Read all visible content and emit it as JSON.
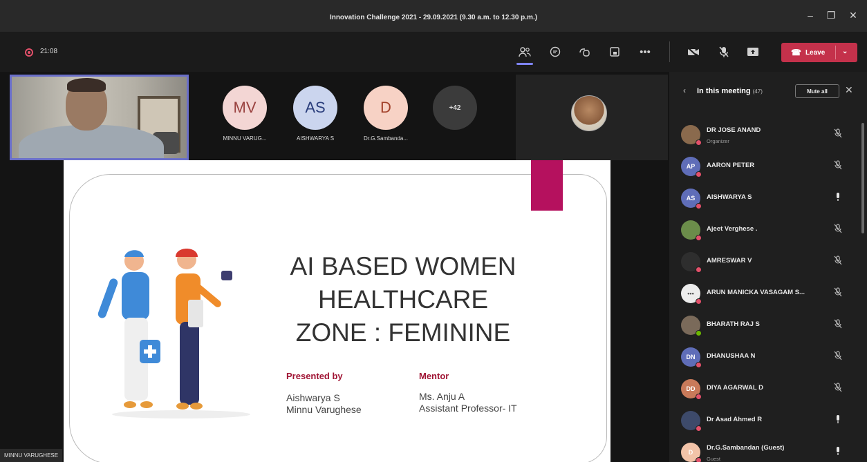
{
  "window": {
    "title": "Innovation Challenge 2021 - 29.09.2021 (9.30 a.m. to 12.30 p.m.)",
    "controls": [
      "minimize",
      "maximize",
      "close"
    ]
  },
  "toolbar": {
    "timer": "21:08",
    "leave_label": "Leave"
  },
  "stage": {
    "self_name": "MINNU VARUGHESE",
    "avatars": [
      {
        "initials": "MV",
        "name": "MINNU VARUG...",
        "color": "#f3d6d4",
        "text_color": "#9a4240"
      },
      {
        "initials": "AS",
        "name": "AISHWARYA S",
        "color": "#cbd5ee",
        "text_color": "#2c3f7d"
      },
      {
        "initials": "D",
        "name": "Dr.G.Sambanda...",
        "color": "#f7d2c5",
        "text_color": "#a2412a"
      }
    ],
    "more_count": "+42"
  },
  "slide": {
    "title_lines": [
      "AI BASED WOMEN",
      "HEALTHCARE",
      "ZONE : FEMININE"
    ],
    "presented_by_label": "Presented by",
    "presenter_lines": [
      "Aishwarya S",
      "Minnu Varughese"
    ],
    "mentor_label": "Mentor",
    "mentor_lines": [
      "Ms. Anju A",
      "Assistant Professor- IT"
    ],
    "accent_color": "#b5115e"
  },
  "panel": {
    "title": "In this meeting",
    "count": "(47)",
    "mute_all_label": "Mute all",
    "participants": [
      {
        "name": "DR JOSE ANAND",
        "role": "Organizer",
        "initials": "",
        "avatar_color": "#8a6a4d",
        "status": "#e3506a",
        "mic": "muted"
      },
      {
        "name": "AARON PETER",
        "role": "",
        "initials": "AP",
        "avatar_color": "#5f6db8",
        "status": "#e3506a",
        "mic": "muted"
      },
      {
        "name": "AISHWARYA S",
        "role": "",
        "initials": "AS",
        "avatar_color": "#5f6db8",
        "status": "#e3506a",
        "mic": "on"
      },
      {
        "name": "Ajeet Verghese .",
        "role": "",
        "initials": "",
        "avatar_color": "#6b8d4a",
        "status": "#e3506a",
        "mic": "muted"
      },
      {
        "name": "AMRESWAR V",
        "role": "",
        "initials": "",
        "avatar_color": "#2e2e2e",
        "status": "#e3506a",
        "mic": "muted"
      },
      {
        "name": "ARUN MANICKA VASAGAM S...",
        "role": "",
        "initials": "•••",
        "avatar_color": "#ececec",
        "status": "#e3506a",
        "mic": "muted"
      },
      {
        "name": "BHARATH RAJ S",
        "role": "",
        "initials": "",
        "avatar_color": "#7a6a5a",
        "status": "#6bb700",
        "mic": "muted"
      },
      {
        "name": "DHANUSHAA N",
        "role": "",
        "initials": "DN",
        "avatar_color": "#5f6db8",
        "status": "#e3506a",
        "mic": "muted"
      },
      {
        "name": "DIYA AGARWAL D",
        "role": "",
        "initials": "DD",
        "avatar_color": "#c97a5a",
        "status": "#e3506a",
        "mic": "muted"
      },
      {
        "name": "Dr Asad Ahmed R",
        "role": "",
        "initials": "",
        "avatar_color": "#3d4a6a",
        "status": "#e3506a",
        "mic": "on"
      },
      {
        "name": "Dr.G.Sambandan (Guest)",
        "role": "Guest",
        "initials": "D",
        "avatar_color": "#f2c3a8",
        "status": "#e3506a",
        "mic": "on"
      }
    ]
  }
}
